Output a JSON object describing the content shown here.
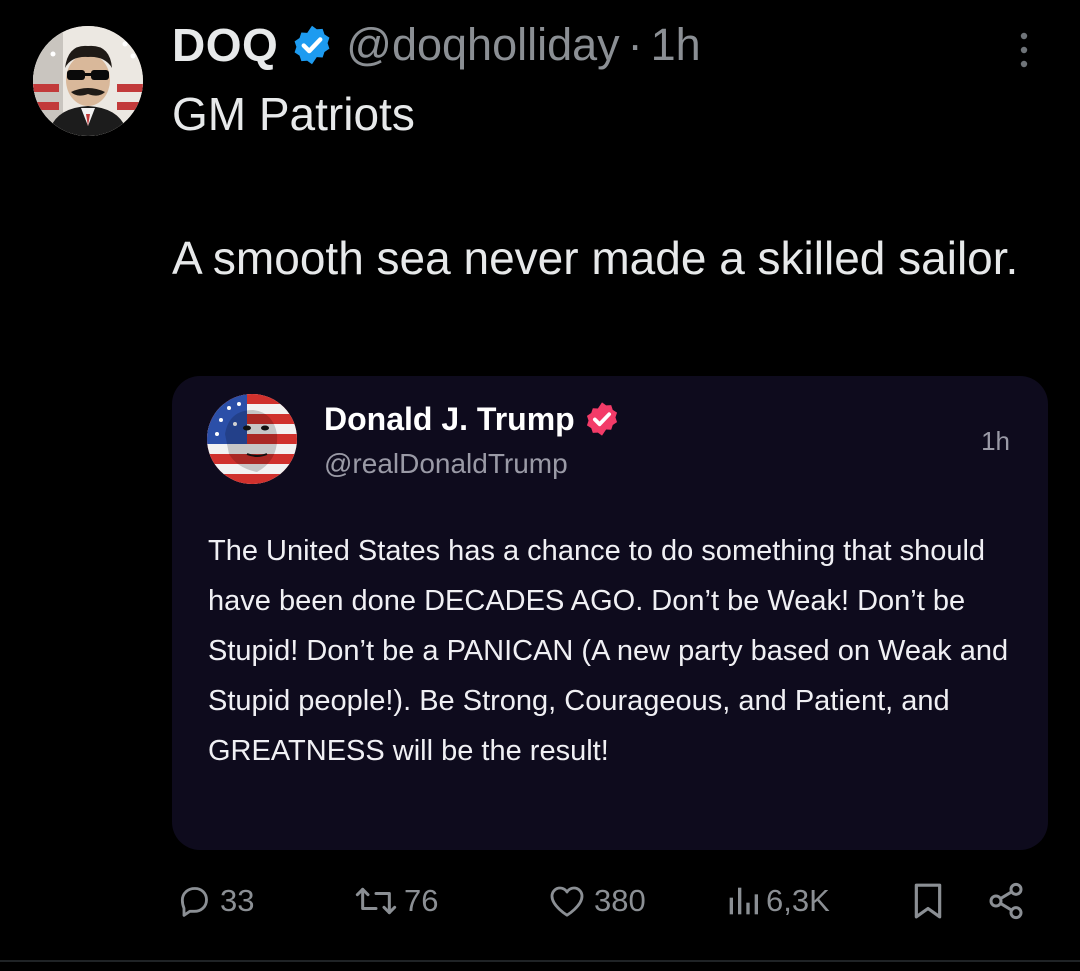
{
  "post": {
    "display_name": "DOQ",
    "handle": "@doqholliday",
    "separator": "·",
    "time": "1h",
    "text_line1": "GM Patriots",
    "text_line2": "A smooth sea never made a skilled sailor.",
    "avatar_icon": "avatar-mustache-man-flag",
    "verified_icon": "verified-badge-icon",
    "more_icon": "more-vertical-icon"
  },
  "quote": {
    "display_name": "Donald J. Trump",
    "handle": "@realDonaldTrump",
    "time": "1h",
    "text": "The United States has a chance to do something that should have been done DECADES AGO. Don’t be Weak! Don’t be Stupid! Don’t be a PANICAN (A new party based on Weak and Stupid people!). Be Strong, Courageous, and Patient, and GREATNESS will be the result!",
    "verified_icon": "verified-badge-icon"
  },
  "actions": {
    "replies": "33",
    "reposts": "76",
    "likes": "380",
    "views": "6,3K",
    "reply_icon": "reply-icon",
    "repost_icon": "repost-icon",
    "like_icon": "heart-icon",
    "views_icon": "views-icon",
    "bookmark_icon": "bookmark-icon",
    "share_icon": "share-icon"
  },
  "colors": {
    "background": "#000000",
    "text": "#e7e9ea",
    "muted": "#8b8f94",
    "verified_blue": "#1d9bf0",
    "verified_pink": "#f33b68",
    "quote_card": "#0e0b1d"
  }
}
